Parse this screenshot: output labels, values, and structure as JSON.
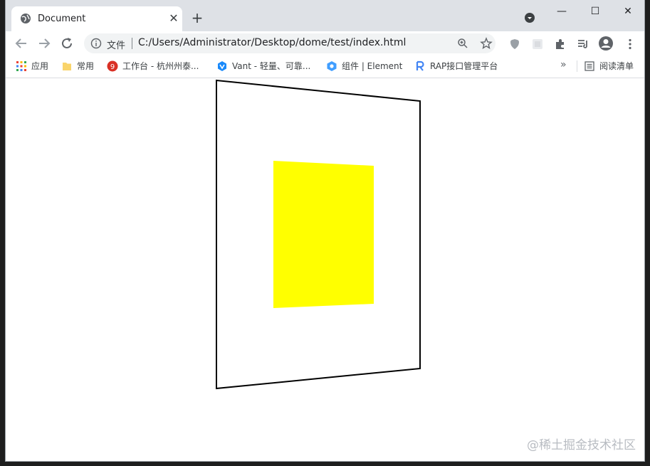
{
  "tab": {
    "title": "Document",
    "close": "✕",
    "new_tab": "+"
  },
  "window_controls": {
    "minimize": "—",
    "maximize": "☐",
    "close": "✕"
  },
  "omnibox": {
    "scheme_label": "文件",
    "url": "C:/Users/Administrator/Desktop/dome/test/index.html"
  },
  "bookmarks": [
    {
      "label": "应用",
      "icon": "apps-grid-icon",
      "color": "#ea4335"
    },
    {
      "label": "常用",
      "icon": "folder-icon",
      "color": "#f9d46b"
    },
    {
      "label": "工作台 - 杭州州泰...",
      "icon": "workbench-icon",
      "color": "#d93025"
    },
    {
      "label": "Vant - 轻量、可靠...",
      "icon": "vant-icon",
      "color": "#1989fa"
    },
    {
      "label": "组件 | Element",
      "icon": "element-icon",
      "color": "#409eff"
    },
    {
      "label": "RAP接口管理平台",
      "icon": "rap-icon",
      "color": "#4285f4"
    }
  ],
  "bookmarks_more": "»",
  "reading_list": "阅读清单",
  "page": {
    "panel_color": "#ffffff",
    "panel_border": "#000000",
    "square_color": "#ffff00"
  },
  "watermark": "@稀土掘金技术社区"
}
